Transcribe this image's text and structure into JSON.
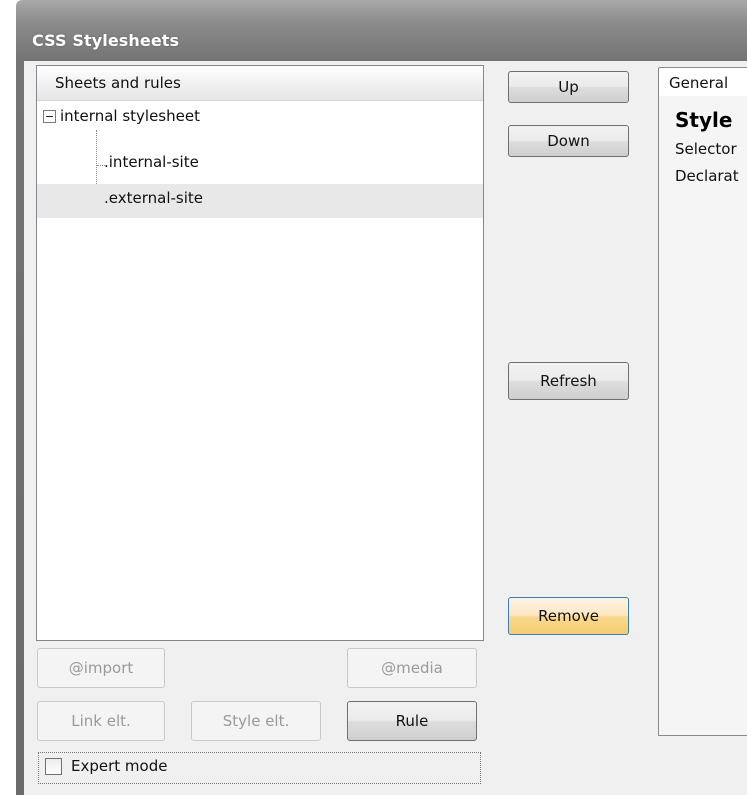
{
  "window": {
    "title": "CSS Stylesheets"
  },
  "tree": {
    "header": "Sheets and rules",
    "items": [
      {
        "label": "internal stylesheet",
        "level": 0,
        "expanded": true,
        "selected": false
      },
      {
        "label": ".internal-site",
        "level": 1,
        "selected": false
      },
      {
        "label": ".external-site",
        "level": 1,
        "selected": true
      }
    ]
  },
  "buttons": {
    "up": "Up",
    "down": "Down",
    "refresh": "Refresh",
    "remove": "Remove",
    "import": "@import",
    "media": "@media",
    "link_elt": "Link elt.",
    "style_elt": "Style elt.",
    "rule": "Rule"
  },
  "tabs": {
    "general": "General"
  },
  "panel": {
    "title": "Style",
    "selector_label": "Selector",
    "declarations_label": "Declarat"
  },
  "expert_mode": {
    "label": "Expert mode",
    "checked": false
  }
}
